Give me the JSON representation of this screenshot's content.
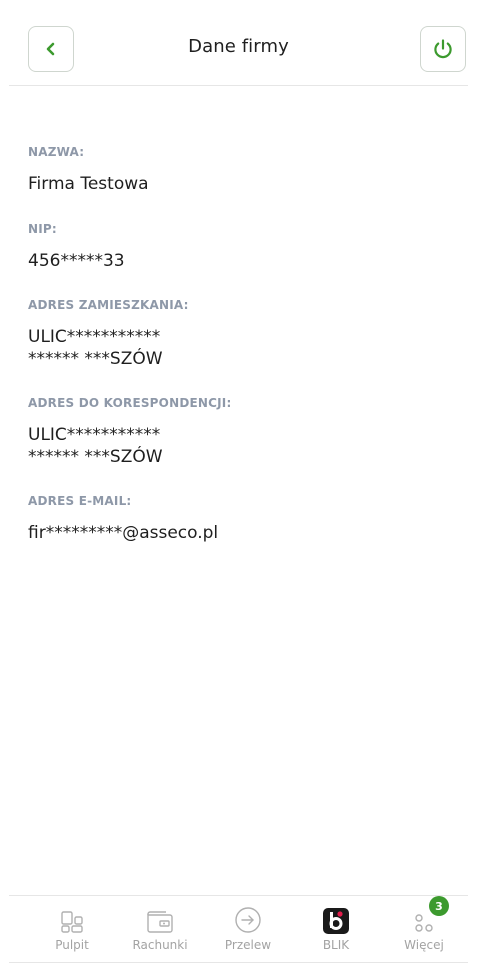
{
  "header": {
    "title": "Dane firmy",
    "back_icon": "chevron-left-icon",
    "power_icon": "power-icon",
    "accent_color": "#3c9a2e"
  },
  "details": {
    "nazwa": {
      "label": "NAZWA:",
      "value": "Firma Testowa"
    },
    "nip": {
      "label": "NIP:",
      "value": "456*****33"
    },
    "adres_zamieszkania": {
      "label": "ADRES ZAMIESZKANIA:",
      "line1": "ULIC***********",
      "line2": "****** ***SZÓW"
    },
    "adres_korespondencji": {
      "label": "ADRES DO KORESPONDENCJI:",
      "line1": "ULIC***********",
      "line2": "****** ***SZÓW"
    },
    "email": {
      "label": "ADRES E-MAIL:",
      "value": "fir*********@asseco.pl"
    }
  },
  "tabbar": {
    "items": [
      {
        "label": "Pulpit",
        "icon": "dashboard-icon"
      },
      {
        "label": "Rachunki",
        "icon": "wallet-icon"
      },
      {
        "label": "Przelew",
        "icon": "transfer-icon"
      },
      {
        "label": "BLIK",
        "icon": "blik-icon"
      },
      {
        "label": "Więcej",
        "icon": "more-icon",
        "badge": "3"
      }
    ]
  }
}
